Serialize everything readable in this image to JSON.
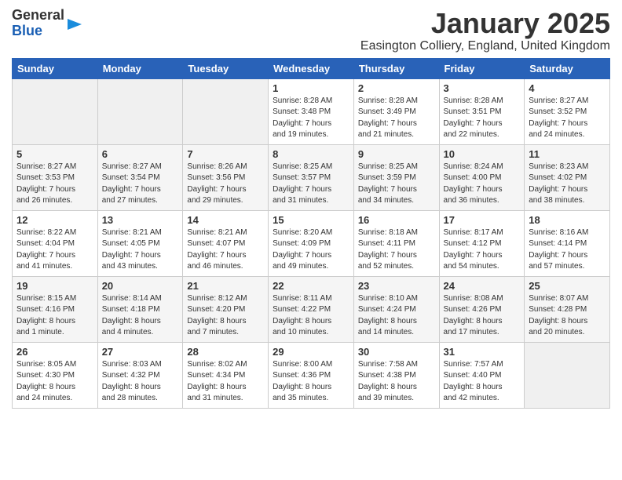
{
  "header": {
    "logo_line1": "General",
    "logo_line2": "Blue",
    "month_title": "January 2025",
    "subtitle": "Easington Colliery, England, United Kingdom"
  },
  "days_of_week": [
    "Sunday",
    "Monday",
    "Tuesday",
    "Wednesday",
    "Thursday",
    "Friday",
    "Saturday"
  ],
  "weeks": [
    [
      {
        "day": "",
        "info": ""
      },
      {
        "day": "",
        "info": ""
      },
      {
        "day": "",
        "info": ""
      },
      {
        "day": "1",
        "info": "Sunrise: 8:28 AM\nSunset: 3:48 PM\nDaylight: 7 hours\nand 19 minutes."
      },
      {
        "day": "2",
        "info": "Sunrise: 8:28 AM\nSunset: 3:49 PM\nDaylight: 7 hours\nand 21 minutes."
      },
      {
        "day": "3",
        "info": "Sunrise: 8:28 AM\nSunset: 3:51 PM\nDaylight: 7 hours\nand 22 minutes."
      },
      {
        "day": "4",
        "info": "Sunrise: 8:27 AM\nSunset: 3:52 PM\nDaylight: 7 hours\nand 24 minutes."
      }
    ],
    [
      {
        "day": "5",
        "info": "Sunrise: 8:27 AM\nSunset: 3:53 PM\nDaylight: 7 hours\nand 26 minutes."
      },
      {
        "day": "6",
        "info": "Sunrise: 8:27 AM\nSunset: 3:54 PM\nDaylight: 7 hours\nand 27 minutes."
      },
      {
        "day": "7",
        "info": "Sunrise: 8:26 AM\nSunset: 3:56 PM\nDaylight: 7 hours\nand 29 minutes."
      },
      {
        "day": "8",
        "info": "Sunrise: 8:25 AM\nSunset: 3:57 PM\nDaylight: 7 hours\nand 31 minutes."
      },
      {
        "day": "9",
        "info": "Sunrise: 8:25 AM\nSunset: 3:59 PM\nDaylight: 7 hours\nand 34 minutes."
      },
      {
        "day": "10",
        "info": "Sunrise: 8:24 AM\nSunset: 4:00 PM\nDaylight: 7 hours\nand 36 minutes."
      },
      {
        "day": "11",
        "info": "Sunrise: 8:23 AM\nSunset: 4:02 PM\nDaylight: 7 hours\nand 38 minutes."
      }
    ],
    [
      {
        "day": "12",
        "info": "Sunrise: 8:22 AM\nSunset: 4:04 PM\nDaylight: 7 hours\nand 41 minutes."
      },
      {
        "day": "13",
        "info": "Sunrise: 8:21 AM\nSunset: 4:05 PM\nDaylight: 7 hours\nand 43 minutes."
      },
      {
        "day": "14",
        "info": "Sunrise: 8:21 AM\nSunset: 4:07 PM\nDaylight: 7 hours\nand 46 minutes."
      },
      {
        "day": "15",
        "info": "Sunrise: 8:20 AM\nSunset: 4:09 PM\nDaylight: 7 hours\nand 49 minutes."
      },
      {
        "day": "16",
        "info": "Sunrise: 8:18 AM\nSunset: 4:11 PM\nDaylight: 7 hours\nand 52 minutes."
      },
      {
        "day": "17",
        "info": "Sunrise: 8:17 AM\nSunset: 4:12 PM\nDaylight: 7 hours\nand 54 minutes."
      },
      {
        "day": "18",
        "info": "Sunrise: 8:16 AM\nSunset: 4:14 PM\nDaylight: 7 hours\nand 57 minutes."
      }
    ],
    [
      {
        "day": "19",
        "info": "Sunrise: 8:15 AM\nSunset: 4:16 PM\nDaylight: 8 hours\nand 1 minute."
      },
      {
        "day": "20",
        "info": "Sunrise: 8:14 AM\nSunset: 4:18 PM\nDaylight: 8 hours\nand 4 minutes."
      },
      {
        "day": "21",
        "info": "Sunrise: 8:12 AM\nSunset: 4:20 PM\nDaylight: 8 hours\nand 7 minutes."
      },
      {
        "day": "22",
        "info": "Sunrise: 8:11 AM\nSunset: 4:22 PM\nDaylight: 8 hours\nand 10 minutes."
      },
      {
        "day": "23",
        "info": "Sunrise: 8:10 AM\nSunset: 4:24 PM\nDaylight: 8 hours\nand 14 minutes."
      },
      {
        "day": "24",
        "info": "Sunrise: 8:08 AM\nSunset: 4:26 PM\nDaylight: 8 hours\nand 17 minutes."
      },
      {
        "day": "25",
        "info": "Sunrise: 8:07 AM\nSunset: 4:28 PM\nDaylight: 8 hours\nand 20 minutes."
      }
    ],
    [
      {
        "day": "26",
        "info": "Sunrise: 8:05 AM\nSunset: 4:30 PM\nDaylight: 8 hours\nand 24 minutes."
      },
      {
        "day": "27",
        "info": "Sunrise: 8:03 AM\nSunset: 4:32 PM\nDaylight: 8 hours\nand 28 minutes."
      },
      {
        "day": "28",
        "info": "Sunrise: 8:02 AM\nSunset: 4:34 PM\nDaylight: 8 hours\nand 31 minutes."
      },
      {
        "day": "29",
        "info": "Sunrise: 8:00 AM\nSunset: 4:36 PM\nDaylight: 8 hours\nand 35 minutes."
      },
      {
        "day": "30",
        "info": "Sunrise: 7:58 AM\nSunset: 4:38 PM\nDaylight: 8 hours\nand 39 minutes."
      },
      {
        "day": "31",
        "info": "Sunrise: 7:57 AM\nSunset: 4:40 PM\nDaylight: 8 hours\nand 42 minutes."
      },
      {
        "day": "",
        "info": ""
      }
    ]
  ]
}
